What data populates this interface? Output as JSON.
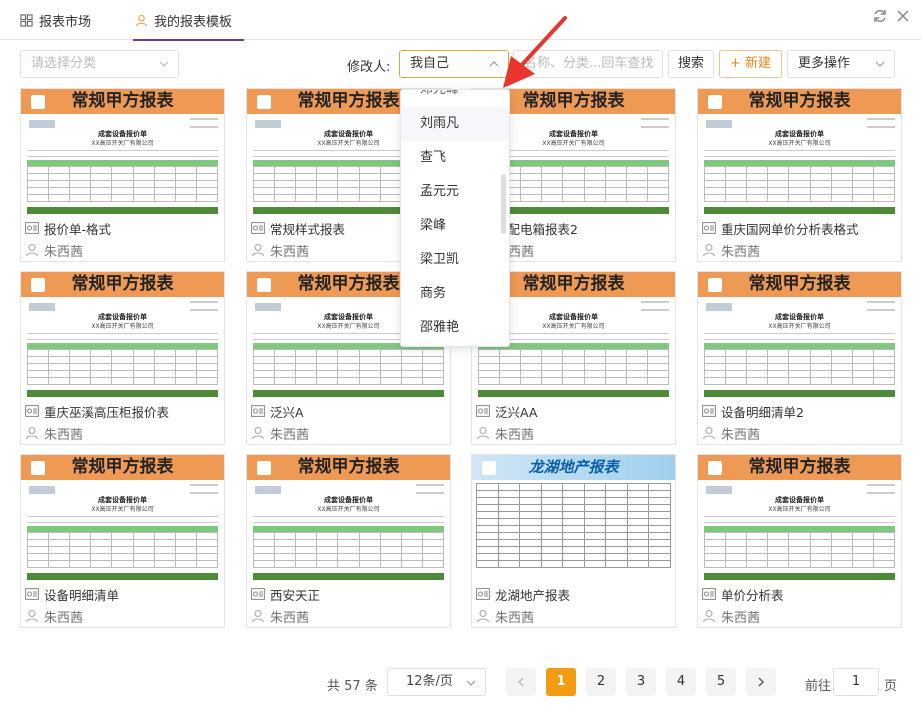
{
  "tabs": [
    {
      "label": "报表市场",
      "icon": "grid-icon"
    },
    {
      "label": "我的报表模板",
      "icon": "user-icon",
      "active": true
    }
  ],
  "toolbar": {
    "category_placeholder": "请选择分类",
    "modifier_label": "修改人:",
    "modifier_value": "我自己",
    "search_placeholder": "名称、分类...回车查找",
    "search_button": "搜索",
    "new_button": "+ 新建",
    "more_button": "更多操作"
  },
  "dropdown": {
    "items": [
      "刘雨凡",
      "查飞",
      "孟元元",
      "梁峰",
      "梁卫凯",
      "商务",
      "邵雅艳"
    ],
    "highlighted": "刘雨凡"
  },
  "thumbnail": {
    "banner": "常规甲方报表",
    "doc_title": "成套设备报价单",
    "doc_subtitle": "XX高压开关厂有限公司",
    "blue_banner": "龙湖地产报表"
  },
  "cards": [
    {
      "name": "报价单-格式",
      "user": "朱西茜",
      "style": "orange"
    },
    {
      "name": "常规样式报表",
      "user": "朱西茜",
      "style": "orange"
    },
    {
      "name": "乙配电箱报表2",
      "user": "朱西茜",
      "style": "orange"
    },
    {
      "name": "重庆国网单价分析表格式",
      "user": "朱西茜",
      "style": "orange"
    },
    {
      "name": "重庆巫溪高压柜报价表",
      "user": "朱西茜",
      "style": "orange"
    },
    {
      "name": "泛兴A",
      "user": "朱西茜",
      "style": "orange"
    },
    {
      "name": "泛兴AA",
      "user": "朱西茜",
      "style": "orange"
    },
    {
      "name": "设备明细清单2",
      "user": "朱西茜",
      "style": "orange"
    },
    {
      "name": "设备明细清单",
      "user": "朱西茜",
      "style": "orange"
    },
    {
      "name": "西安天正",
      "user": "朱西茜",
      "style": "orange"
    },
    {
      "name": "龙湖地产报表",
      "user": "朱西茜",
      "style": "blue"
    },
    {
      "name": "单价分析表",
      "user": "朱西茜",
      "style": "orange"
    }
  ],
  "pager": {
    "total": "共 57 条",
    "page_size": "12条/页",
    "pages": [
      "1",
      "2",
      "3",
      "4",
      "5"
    ],
    "current": "1",
    "goto_label": "前往",
    "goto_value": "1",
    "goto_unit": "页"
  },
  "colors": {
    "accent": "#f39c12",
    "banner_orange": "#ee9a55",
    "tab_underline": "#6b3f8d",
    "annotation": "#e8352e"
  }
}
